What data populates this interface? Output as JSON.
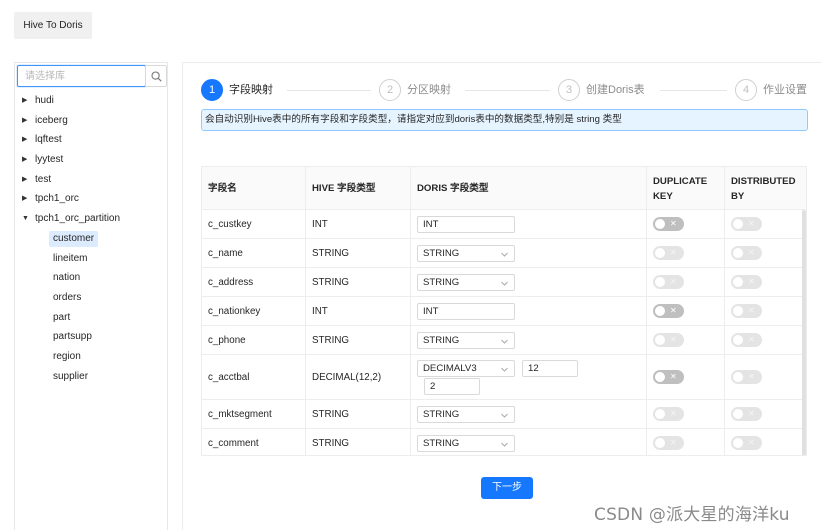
{
  "top_tab": {
    "label": "Hive To Doris"
  },
  "sidebar": {
    "search_placeholder": "请选择库",
    "databases": [
      {
        "label": "hudi",
        "expanded": false
      },
      {
        "label": "iceberg",
        "expanded": false
      },
      {
        "label": "lqftest",
        "expanded": false
      },
      {
        "label": "lyytest",
        "expanded": false
      },
      {
        "label": "test",
        "expanded": false
      },
      {
        "label": "tpch1_orc",
        "expanded": false
      },
      {
        "label": "tpch1_orc_partition",
        "expanded": true
      }
    ],
    "tables": [
      {
        "label": "customer",
        "selected": true
      },
      {
        "label": "lineitem",
        "selected": false
      },
      {
        "label": "nation",
        "selected": false
      },
      {
        "label": "orders",
        "selected": false
      },
      {
        "label": "part",
        "selected": false
      },
      {
        "label": "partsupp",
        "selected": false
      },
      {
        "label": "region",
        "selected": false
      },
      {
        "label": "supplier",
        "selected": false
      }
    ]
  },
  "steps": [
    {
      "number": "1",
      "title": "字段映射",
      "active": true
    },
    {
      "number": "2",
      "title": "分区映射",
      "active": false
    },
    {
      "number": "3",
      "title": "创建Doris表",
      "active": false
    },
    {
      "number": "4",
      "title": "作业设置",
      "active": false
    }
  ],
  "alert": {
    "text": "会自动识别Hive表中的所有字段和字段类型，请指定对应到doris表中的数据类型,特别是 string 类型"
  },
  "table": {
    "headers": {
      "field": "字段名",
      "hive_type": "HIVE 字段类型",
      "doris_type": "DORIS 字段类型",
      "dup_key_1": "DUPLICATE",
      "dup_key_2": "KEY",
      "dist_by_1": "DISTRIBUTED",
      "dist_by_2": "BY"
    },
    "rows": [
      {
        "field": "c_custkey",
        "hive_type": "INT",
        "doris_type": "INT",
        "doris_control": "input",
        "dup_key_enabled": true,
        "dist_by_enabled": false
      },
      {
        "field": "c_name",
        "hive_type": "STRING",
        "doris_type": "STRING",
        "doris_control": "select",
        "dup_key_enabled": false,
        "dist_by_enabled": false
      },
      {
        "field": "c_address",
        "hive_type": "STRING",
        "doris_type": "STRING",
        "doris_control": "select",
        "dup_key_enabled": false,
        "dist_by_enabled": false
      },
      {
        "field": "c_nationkey",
        "hive_type": "INT",
        "doris_type": "INT",
        "doris_control": "input",
        "dup_key_enabled": true,
        "dist_by_enabled": false
      },
      {
        "field": "c_phone",
        "hive_type": "STRING",
        "doris_type": "STRING",
        "doris_control": "select",
        "dup_key_enabled": false,
        "dist_by_enabled": false
      },
      {
        "field": "c_acctbal",
        "hive_type": "DECIMAL(12,2)",
        "doris_type": "DECIMALV3",
        "doris_control": "select",
        "precision": "12",
        "scale": "2",
        "dup_key_enabled": true,
        "dist_by_enabled": false
      },
      {
        "field": "c_mktsegment",
        "hive_type": "STRING",
        "doris_type": "STRING",
        "doris_control": "select",
        "dup_key_enabled": false,
        "dist_by_enabled": false
      },
      {
        "field": "c_comment",
        "hive_type": "STRING",
        "doris_type": "STRING",
        "doris_control": "select",
        "dup_key_enabled": false,
        "dist_by_enabled": false
      }
    ]
  },
  "switch_off_glyph": "✕",
  "next_button": {
    "label": "下一步"
  },
  "watermark": {
    "text": "CSDN @派大星的海洋ku"
  },
  "colors": {
    "primary": "#1677ff",
    "alert_bg": "#e6f4ff",
    "alert_border": "#91caff",
    "selected_bg": "#dcebfd"
  }
}
